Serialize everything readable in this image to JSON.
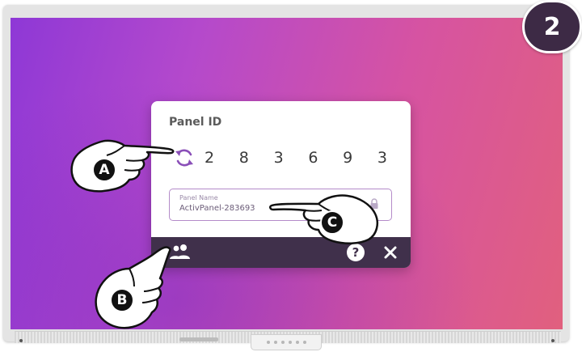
{
  "badge": {
    "step": "2"
  },
  "dialog": {
    "title": "Panel ID",
    "panel_id_digits": [
      "2",
      "8",
      "3",
      "6",
      "9",
      "3"
    ],
    "name_field": {
      "label": "Panel Name",
      "value": "ActivPanel-283693"
    },
    "footer": {
      "help_label": "?"
    }
  },
  "annotations": {
    "a": "A",
    "b": "B",
    "c": "C"
  },
  "colors": {
    "accent": "#8a4fb8",
    "footer": "#40304b",
    "badge": "#3d2a45",
    "field_border": "#b48bc9"
  },
  "icons": [
    "refresh-icon",
    "lock-icon",
    "users-icon",
    "help-icon",
    "close-icon",
    "pointing-hand-icon"
  ]
}
